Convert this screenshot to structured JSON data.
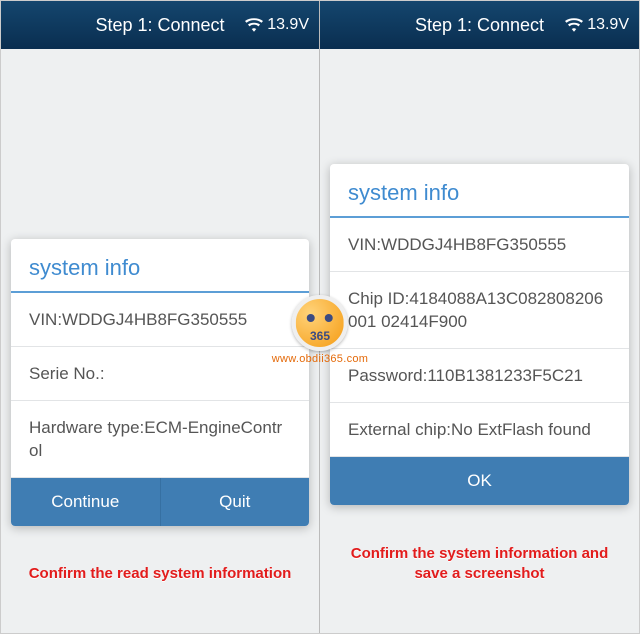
{
  "watermark": {
    "number": "365",
    "url": "www.obdii365.com"
  },
  "left": {
    "header": {
      "title": "Step 1: Connect",
      "voltage": "13.9V"
    },
    "dialog": {
      "title": "system info",
      "rows": [
        "VIN:WDDGJ4HB8FG350555",
        "Serie No.:",
        "Hardware type:ECM-EngineControl"
      ],
      "buttons": {
        "continue": "Continue",
        "quit": "Quit"
      }
    },
    "caption": "Confirm the read system information"
  },
  "right": {
    "header": {
      "title": "Step 1: Connect",
      "voltage": "13.9V"
    },
    "dialog": {
      "title": "system info",
      "rows": [
        "VIN:WDDGJ4HB8FG350555",
        "Chip ID:4184088A13C082808206001\n02414F900",
        "Password:110B1381233F5C21",
        "External chip:No ExtFlash found"
      ],
      "buttons": {
        "ok": "OK"
      }
    },
    "caption": "Confirm the system information and save a screenshot"
  }
}
